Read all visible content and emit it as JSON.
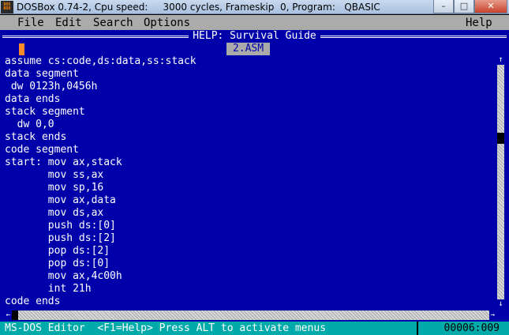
{
  "window": {
    "icon_top": "DOS",
    "icon_bottom": "BOX",
    "title": "DOSBox 0.74-2, Cpu speed:     3000 cycles, Frameskip  0, Program:   QBASIC",
    "minimize_glyph": "–",
    "maximize_glyph": "□",
    "close_glyph": "✕"
  },
  "menu": {
    "items": [
      "File",
      "Edit",
      "Search",
      "Options"
    ],
    "help": "Help"
  },
  "help_window": {
    "title": "HELP: Survival Guide",
    "file_tab": "2.ASM"
  },
  "code_lines": [
    "assume cs:code,ds:data,ss:stack",
    "data segment",
    " dw 0123h,0456h",
    "data ends",
    "stack segment",
    "  dw 0,0",
    "stack ends",
    "code segment",
    "start: mov ax,stack",
    "       mov ss,ax",
    "       mov sp,16",
    "       mov ax,data",
    "       mov ds,ax",
    "       push ds:[0]",
    "       push ds:[2]",
    "       pop ds:[2]",
    "       pop ds:[0]",
    "       mov ax,4c00h",
    "       int 21h",
    "code ends"
  ],
  "scrollbar": {
    "up_arrow": "↑",
    "down_arrow": "↓",
    "left_arrow": "←",
    "right_arrow": "→"
  },
  "status": {
    "left": "MS-DOS Editor  <F1=Help> Press ALT to activate menus",
    "position": "00006:009"
  },
  "colors": {
    "editor_bg": "#0000aa",
    "status_bg": "#00aaaa",
    "menu_bg": "#ababab",
    "cursor": "#ff8a2a"
  }
}
